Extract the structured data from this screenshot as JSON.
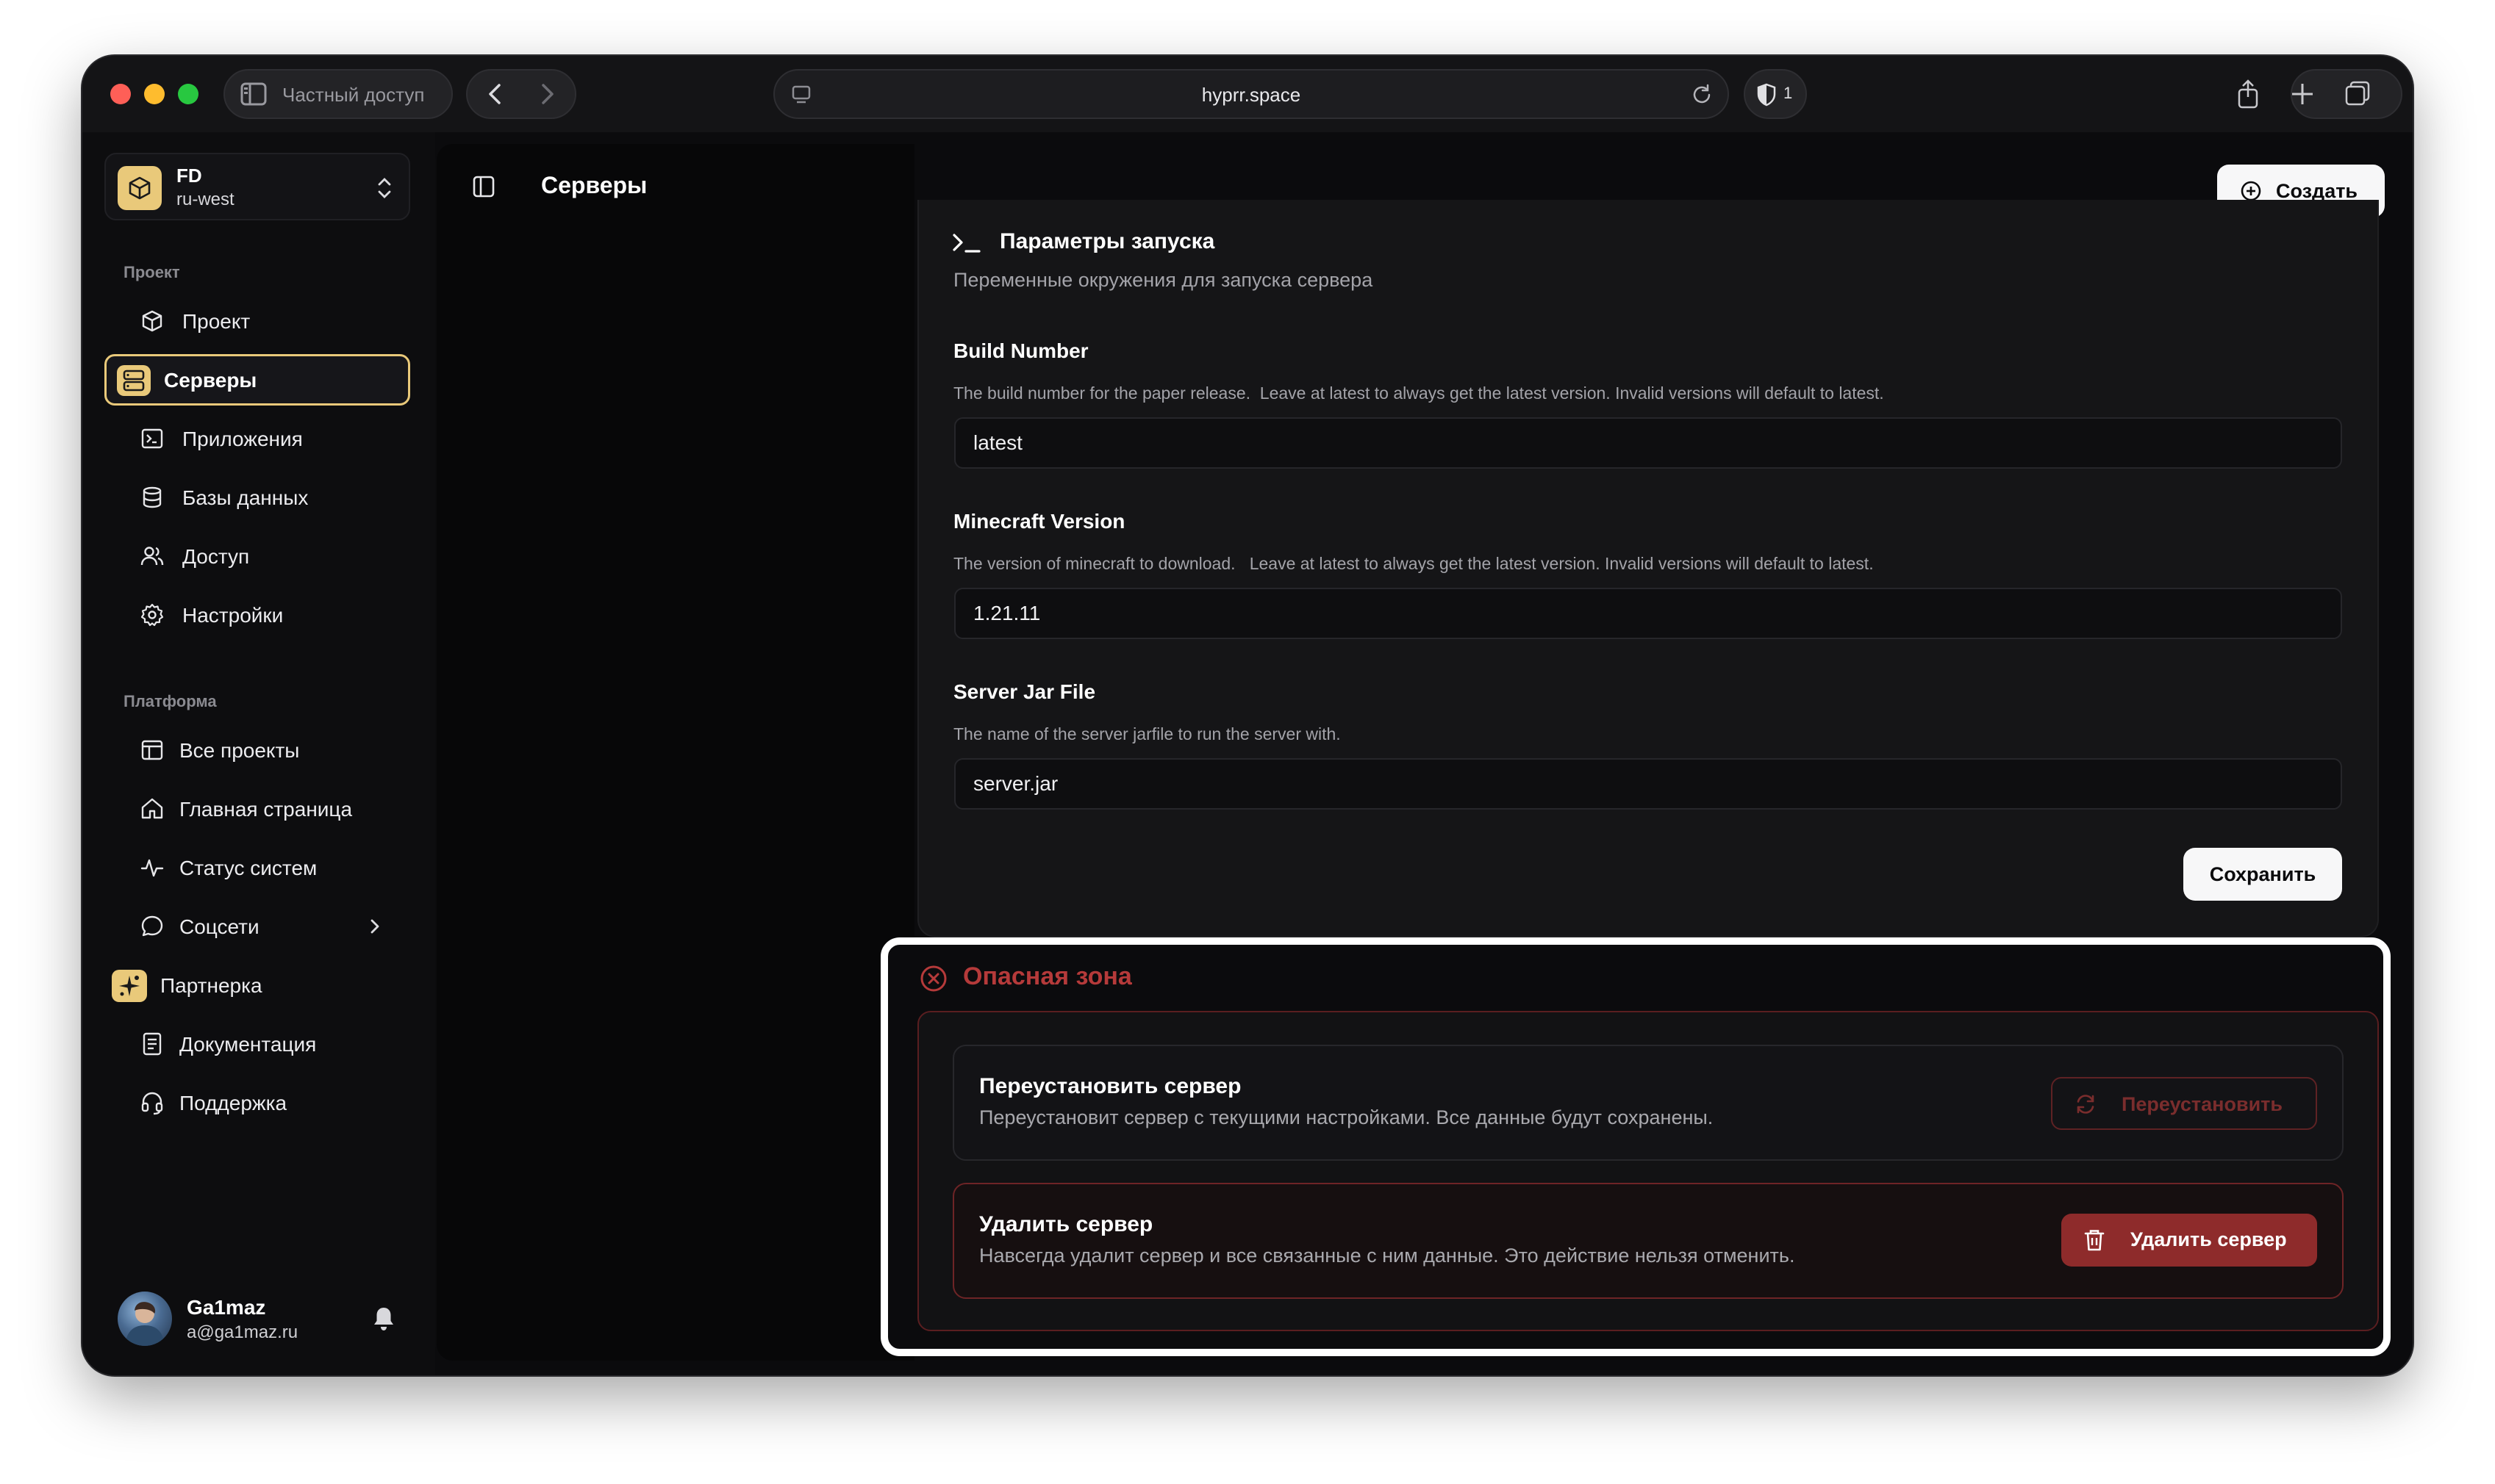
{
  "browser": {
    "private_label": "Частный доступ",
    "url": "hyprr.space",
    "shield_count": "1"
  },
  "team": {
    "name": "FD",
    "region": "ru-west"
  },
  "sidebar": {
    "project_group": "Проект",
    "project_items": [
      {
        "label": "Проект",
        "icon": "cube-icon"
      },
      {
        "label": "Серверы",
        "icon": "server-icon",
        "active": true
      },
      {
        "label": "Приложения",
        "icon": "terminal-icon"
      },
      {
        "label": "Базы данных",
        "icon": "database-icon"
      },
      {
        "label": "Доступ",
        "icon": "users-icon"
      },
      {
        "label": "Настройки",
        "icon": "gear-icon"
      }
    ],
    "platform_group": "Платформа",
    "platform_items": [
      {
        "label": "Все проекты",
        "icon": "layout-icon"
      },
      {
        "label": "Главная страница",
        "icon": "home-icon"
      },
      {
        "label": "Статус систем",
        "icon": "activity-icon"
      },
      {
        "label": "Соцсети",
        "icon": "chat-icon"
      },
      {
        "label": "Партнерка",
        "icon": "sparkle-icon"
      },
      {
        "label": "Документация",
        "icon": "document-icon"
      },
      {
        "label": "Поддержка",
        "icon": "headset-icon"
      }
    ]
  },
  "user": {
    "name": "Ga1maz",
    "email": "a@ga1maz.ru"
  },
  "header": {
    "title": "Серверы",
    "create_label": "Создать"
  },
  "launch": {
    "title": "Параметры запуска",
    "description": "Переменные окружения для запуска сервера",
    "fields": [
      {
        "label": "Build Number",
        "help": "The build number for the paper release.  Leave at latest to always get the latest version. Invalid versions will default to latest.",
        "value": "latest"
      },
      {
        "label": "Minecraft Version",
        "help": "The version of minecraft to download.   Leave at latest to always get the latest version. Invalid versions will default to latest.",
        "value": "1.21.11"
      },
      {
        "label": "Server Jar File",
        "help": "The name of the server jarfile to run the server with.",
        "value": "server.jar"
      }
    ],
    "save_label": "Сохранить"
  },
  "danger": {
    "title": "Опасная зона",
    "reinstall": {
      "title": "Переустановить сервер",
      "description": "Переустановит сервер с текущими настройками. Все данные будут сохранены.",
      "button": "Переустановить"
    },
    "delete": {
      "title": "Удалить сервер",
      "description": "Навсегда удалит сервер и все связанные с ним данные. Это действие нельзя отменить.",
      "button": "Удалить сервер"
    }
  },
  "colors": {
    "accent": "#e9c97a",
    "danger": "#8e2b2b",
    "background": "#0b0b0d"
  }
}
